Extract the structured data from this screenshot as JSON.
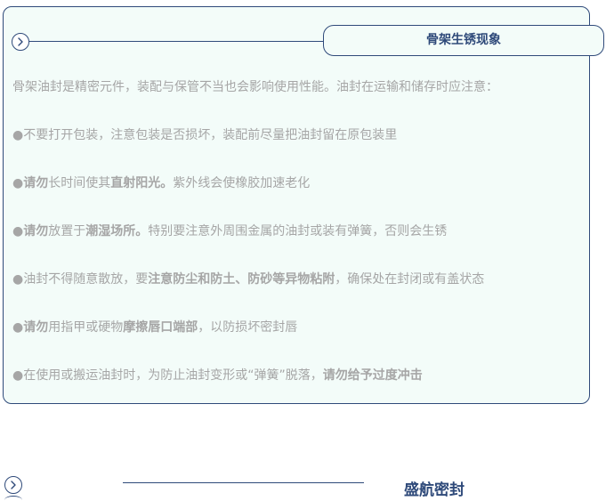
{
  "header": {
    "icon": "chevron-right-circle-icon",
    "title": "骨架生锈现象"
  },
  "content": {
    "intro": "骨架油封是精密元件，装配与保管不当也会影响使用性能。油封在运输和储存时应注意：",
    "items": [
      {
        "bullet": "●",
        "text": "不要打开包装，注意包装是否损坏，装配前尽量把油封留在原包装里"
      },
      {
        "bullet": "●",
        "bold1": "请勿",
        "text1": "长时间使其",
        "bold2": "直射阳光。",
        "text2": "紫外线会使橡胶加速老化"
      },
      {
        "bullet": "●",
        "bold1": "请勿",
        "text1": "放置于",
        "bold2": "潮湿场所。",
        "text2": "特别要注意外周围金属的油封或装有弹簧，否则会生锈"
      },
      {
        "bullet": "●",
        "text1": "油封不得随意散放，要",
        "bold1": "注意防尘和防土、防砂等异物粘附",
        "text2": "，确保处在封闭或有盖状态"
      },
      {
        "bullet": "●",
        "bold1": "请勿",
        "text1": "用指甲或硬物",
        "bold2": "摩擦唇口端部",
        "text2": "，以防损坏密封唇"
      },
      {
        "bullet": "●",
        "text1": "在使用或搬运油封时，为防止油封变形或“弹簧”脱落，",
        "bold1": "请勿给予过度冲击"
      }
    ]
  },
  "footer": {
    "icon": "chevron-right-circle-icon",
    "brand": "盛航密封"
  },
  "colors": {
    "accent": "#2f4a7a",
    "card_background": "#f3fcf9",
    "body_text": "#a6a6a6"
  }
}
